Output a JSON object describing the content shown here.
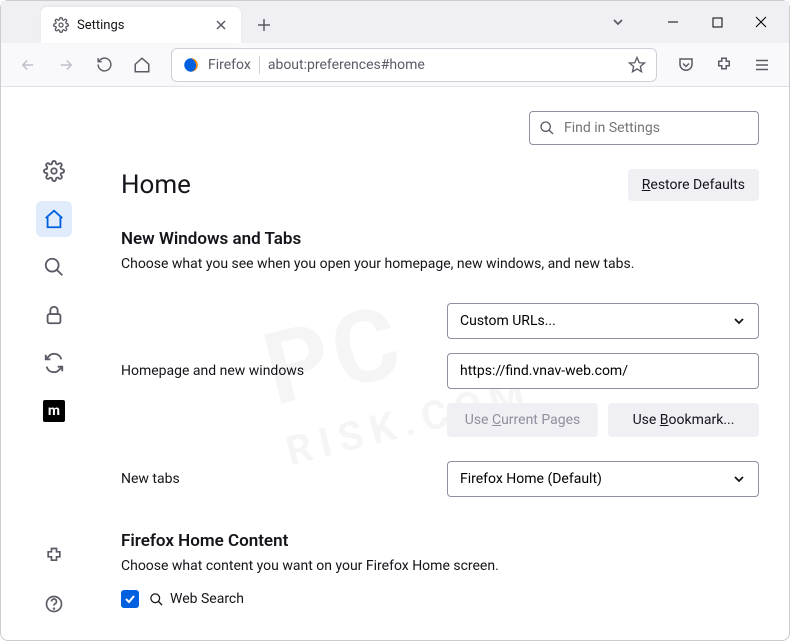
{
  "tab": {
    "title": "Settings"
  },
  "urlbar": {
    "label": "Firefox",
    "url": "about:preferences#home"
  },
  "find": {
    "placeholder": "Find in Settings"
  },
  "page": {
    "title": "Home",
    "restore": "estore Defaults",
    "section1_title": "New Windows and Tabs",
    "section1_desc": "Choose what you see when you open your homepage, new windows, and new tabs.",
    "homepage_select": "Custom URLs...",
    "homepage_label": "Homepage and new windows",
    "homepage_url": "https://find.vnav-web.com/",
    "use_current": "urrent Pages",
    "use_bookmark": "ookmark...",
    "newtabs_label": "New tabs",
    "newtabs_select": "Firefox Home (Default)",
    "section2_title": "Firefox Home Content",
    "section2_desc": "Choose what content you want on your Firefox Home screen.",
    "websearch": "Web Search"
  }
}
